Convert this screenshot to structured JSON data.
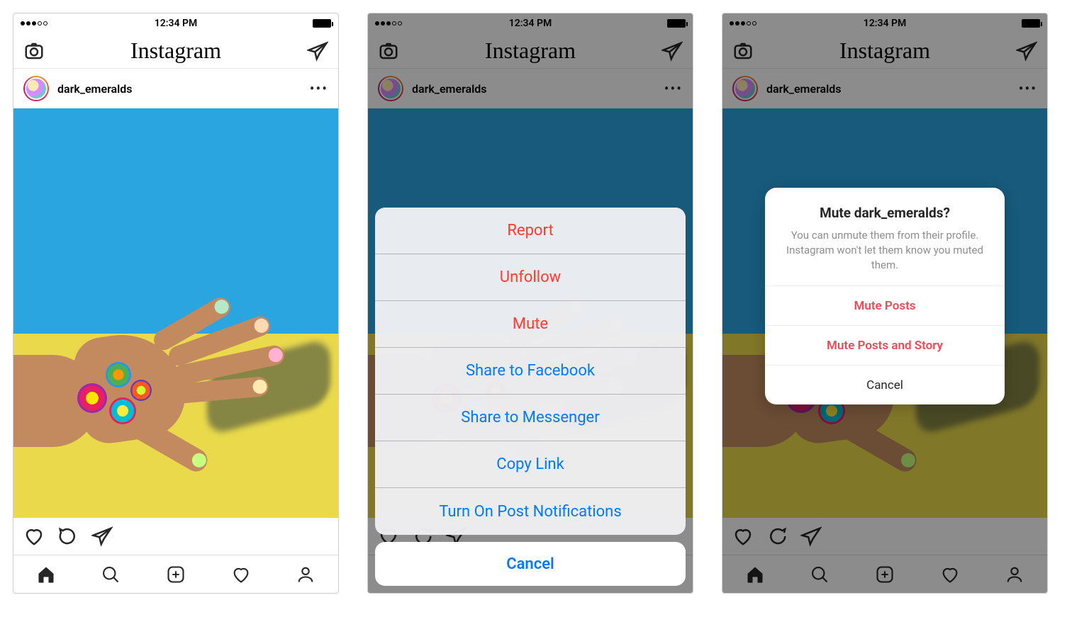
{
  "statusbar": {
    "time": "12:34 PM"
  },
  "app": {
    "logo": "Instagram"
  },
  "post": {
    "username": "dark_emeralds"
  },
  "actionsheet": {
    "items": [
      {
        "label": "Report",
        "style": "red"
      },
      {
        "label": "Unfollow",
        "style": "red"
      },
      {
        "label": "Mute",
        "style": "red"
      },
      {
        "label": "Share to Facebook",
        "style": "blue"
      },
      {
        "label": "Share to Messenger",
        "style": "blue"
      },
      {
        "label": "Copy Link",
        "style": "blue"
      },
      {
        "label": "Turn On Post Notifications",
        "style": "blue"
      }
    ],
    "cancel": "Cancel"
  },
  "mute_dialog": {
    "title": "Mute dark_emeralds?",
    "body": "You can unmute them from their profile. Instagram won't let them know you muted them.",
    "option_posts": "Mute Posts",
    "option_posts_story": "Mute Posts and Story",
    "cancel": "Cancel"
  }
}
